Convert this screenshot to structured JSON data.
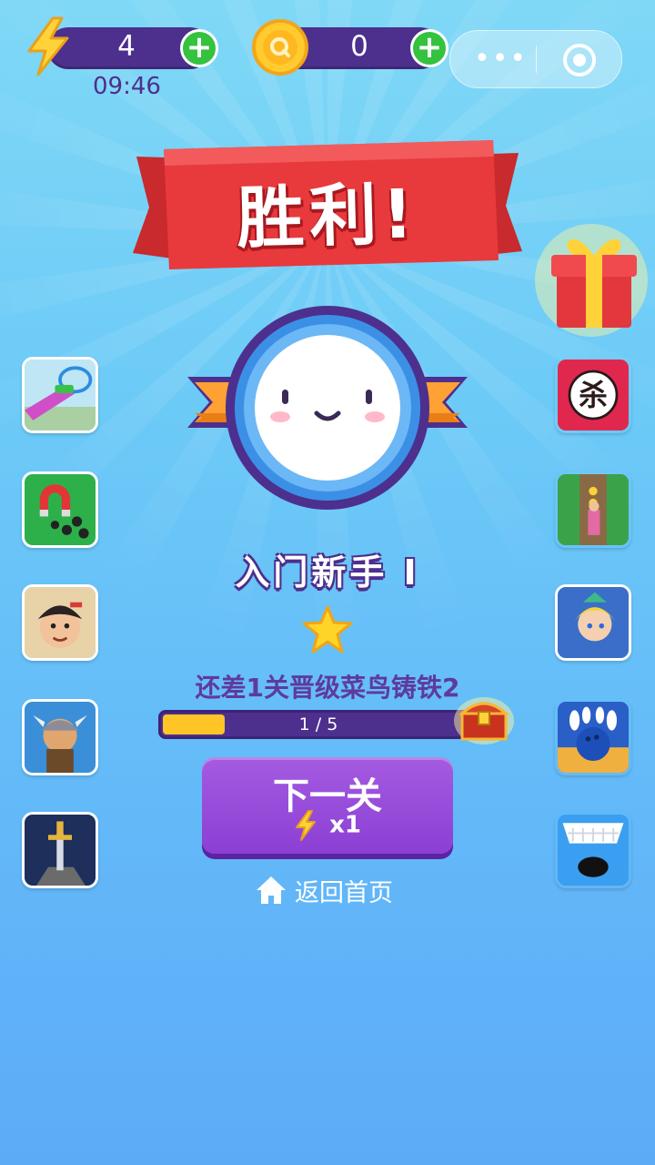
{
  "hud": {
    "energy_value": "4",
    "coin_value": "0",
    "timer": "09:46",
    "plus_symbol": "+",
    "menu_dots": "•••"
  },
  "result": {
    "title": "胜利!",
    "rank_name": "入门新手 I",
    "next_level_text": "还差1关晋级菜鸟铸铁2",
    "progress_text": "1 / 5",
    "progress_fraction": 0.2
  },
  "actions": {
    "next_label": "下一关",
    "next_cost": "x1",
    "home_label": "返回首页"
  },
  "side_games": {
    "left": [
      "racing-ramp-game",
      "magnet-balls-game",
      "cartoon-boy-game",
      "viking-warrior-game",
      "sword-stone-game"
    ],
    "right": [
      "kill-target-game",
      "subway-runner-game",
      "fantasy-hero-game",
      "bowling-game",
      "hole-blocks-game"
    ],
    "kill_glyph": "杀"
  },
  "colors": {
    "purple": "#4d2f8e",
    "button_purple": "#8c3fd4",
    "banner_red": "#e8393c",
    "plus_green": "#34c23f",
    "progress_yellow": "#ffc425"
  }
}
